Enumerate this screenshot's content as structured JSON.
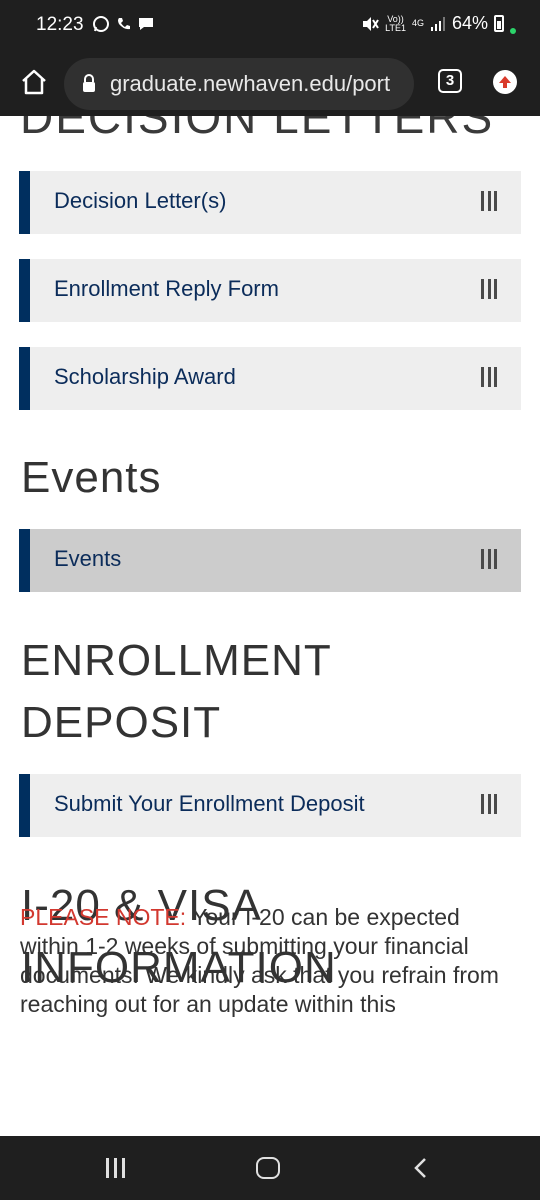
{
  "status_bar": {
    "time": "12:23",
    "network_top": "Vo))",
    "network_bottom": "LTE1",
    "network_type": "4G",
    "battery": "64%",
    "icons": [
      "whatsapp-icon",
      "phone-icon",
      "message-icon",
      "mute-icon",
      "signal-icon",
      "battery-icon"
    ]
  },
  "browser": {
    "url": "graduate.newhaven.edu/port",
    "tab_count": "3",
    "icons": [
      "home-icon",
      "lock-icon",
      "tabs-icon",
      "update-icon"
    ]
  },
  "page": {
    "cut_heading": "DECISION LETTERS",
    "decision_items": [
      {
        "label": "Decision Letter(s)"
      },
      {
        "label": "Enrollment Reply Form"
      },
      {
        "label": "Scholarship Award"
      }
    ],
    "events_heading": "Events",
    "events_items": [
      {
        "label": "Events",
        "active": true
      }
    ],
    "deposit_heading_line1": "ENROLLMENT",
    "deposit_heading_line2": "DEPOSIT",
    "deposit_items": [
      {
        "label": "Submit Your Enrollment Deposit"
      }
    ],
    "visa_heading_line1": "I-20 & VISA",
    "visa_heading_line2": "INFORMATION",
    "note_label": "PLEASE NOTE:",
    "note_text": " Your I-20 can be expected within 1-2 weeks of submitting your financial documents. We kindly ask that you refrain from reaching out for an update within this"
  },
  "colors": {
    "accent_navy": "#002f5f",
    "note_red": "#d2382f",
    "item_bg": "#eeeeee",
    "item_active_bg": "#cccccc"
  }
}
